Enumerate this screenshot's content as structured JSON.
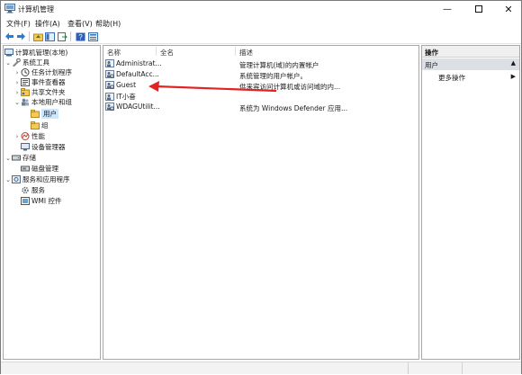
{
  "window": {
    "title": "计算机管理"
  },
  "menu": [
    "文件(F)",
    "操作(A)",
    "查看(V)",
    "帮助(H)"
  ],
  "tree": [
    {
      "label": "计算机管理(本地)",
      "expander": ""
    },
    {
      "label": "系统工具",
      "expander": "⌄"
    },
    {
      "label": "任务计划程序",
      "expander": "›"
    },
    {
      "label": "事件查看器",
      "expander": "›"
    },
    {
      "label": "共享文件夹",
      "expander": "›"
    },
    {
      "label": "本地用户和组",
      "expander": "⌄"
    },
    {
      "label": "用户",
      "expander": ""
    },
    {
      "label": "组",
      "expander": ""
    },
    {
      "label": "性能",
      "expander": "›"
    },
    {
      "label": "设备管理器",
      "expander": ""
    },
    {
      "label": "存储",
      "expander": "⌄"
    },
    {
      "label": "磁盘管理",
      "expander": ""
    },
    {
      "label": "服务和应用程序",
      "expander": "⌄"
    },
    {
      "label": "服务",
      "expander": ""
    },
    {
      "label": "WMI 控件",
      "expander": ""
    }
  ],
  "list": {
    "columns": [
      "名称",
      "全名",
      "描述"
    ],
    "rows": [
      {
        "name": "Administrat...",
        "fullname": "",
        "desc": "管理计算机(域)的内置帐户"
      },
      {
        "name": "DefaultAcc...",
        "fullname": "",
        "desc": "系统管理的用户帐户。"
      },
      {
        "name": "Guest",
        "fullname": "",
        "desc": "供来宾访问计算机或访问域的内..."
      },
      {
        "name": "IT小奋",
        "fullname": "",
        "desc": ""
      },
      {
        "name": "WDAGUtilit...",
        "fullname": "",
        "desc": "系统为 Windows Defender 应用..."
      }
    ]
  },
  "actions": {
    "header": "操作",
    "group": "用户",
    "item": "更多操作"
  },
  "colors": {
    "accent": "#cce8ff",
    "arrow": "#e02424"
  }
}
